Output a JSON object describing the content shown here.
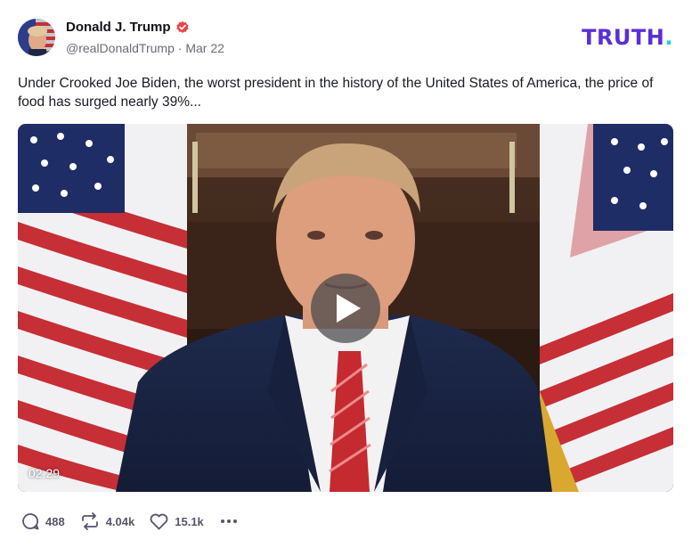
{
  "author": {
    "name": "Donald J. Trump",
    "handle": "@realDonaldTrump",
    "separator": "·",
    "date": "Mar 22",
    "verified": true
  },
  "brand": {
    "logo_text": "TRUTH",
    "logo_dot": ".",
    "color": "#5a2fd6",
    "dot_color": "#18d9c5"
  },
  "post": {
    "text": "Under Crooked Joe Biden, the worst president in the history of the United States of America, the price of food has surged nearly 39%..."
  },
  "video": {
    "duration": "02:29",
    "play_icon": "play-icon"
  },
  "actions": {
    "replies": {
      "icon": "comment-icon",
      "count": "488"
    },
    "retruths": {
      "icon": "repost-icon",
      "count": "4.04k"
    },
    "likes": {
      "icon": "heart-icon",
      "count": "15.1k"
    },
    "more": {
      "icon": "more-icon"
    }
  }
}
